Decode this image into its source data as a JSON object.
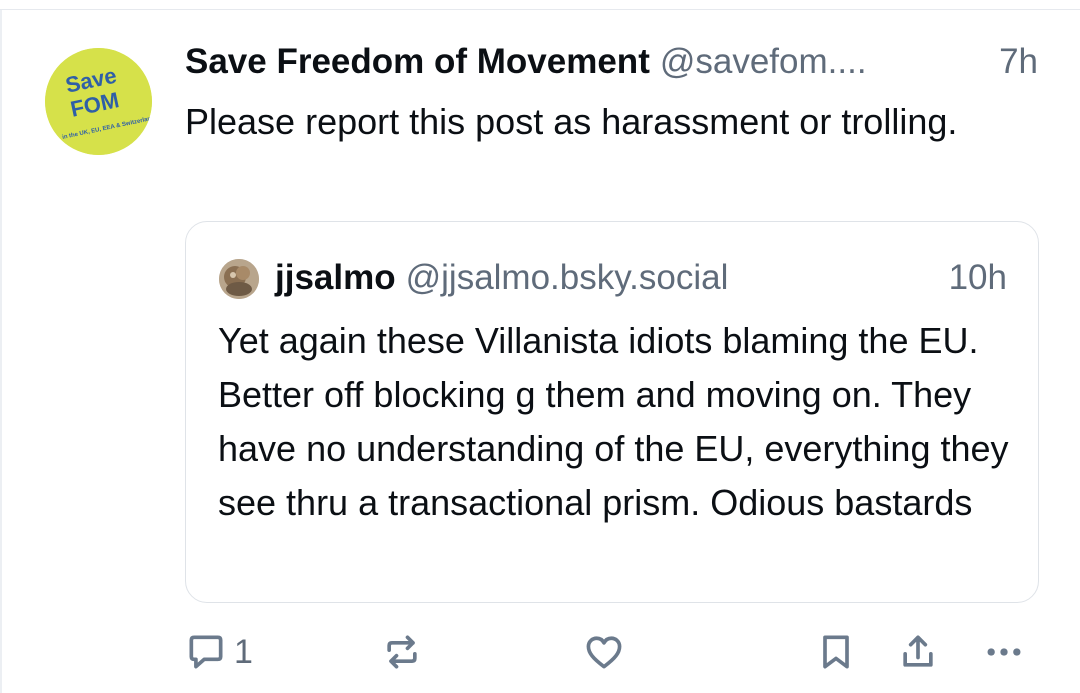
{
  "post": {
    "avatar": {
      "logo_text": [
        "Save",
        "FOM"
      ],
      "logo_subtext": "in the UK, EU, EEA & Switzerland",
      "colors": {
        "background": "#d6e14a",
        "text": "#2f5fa7"
      }
    },
    "author": {
      "display_name": "Save Freedom of Movement",
      "handle": "@savefom....",
      "time": "7h"
    },
    "text": "Please report this post as harassment or trolling.",
    "quote": {
      "author": {
        "display_name": "jjsalmo",
        "handle": "@jjsalmo.bsky.social",
        "time": "10h"
      },
      "text": "Yet again these Villanista idiots blaming the EU. Better off blocking g them and moving on. They have no understanding of the EU, everything they see thru a transactional prism. Odious bastards"
    },
    "actions": {
      "reply": {
        "icon": "reply-icon",
        "count": "1"
      },
      "repost": {
        "icon": "repost-icon"
      },
      "like": {
        "icon": "heart-icon"
      },
      "bookmark": {
        "icon": "bookmark-icon"
      },
      "share": {
        "icon": "share-icon"
      },
      "more": {
        "icon": "more-icon"
      }
    }
  },
  "theme": {
    "text": "#0b0f14",
    "muted": "#5f6b7a",
    "border": "#dfe3e8",
    "icon": "#6b7a8c"
  }
}
